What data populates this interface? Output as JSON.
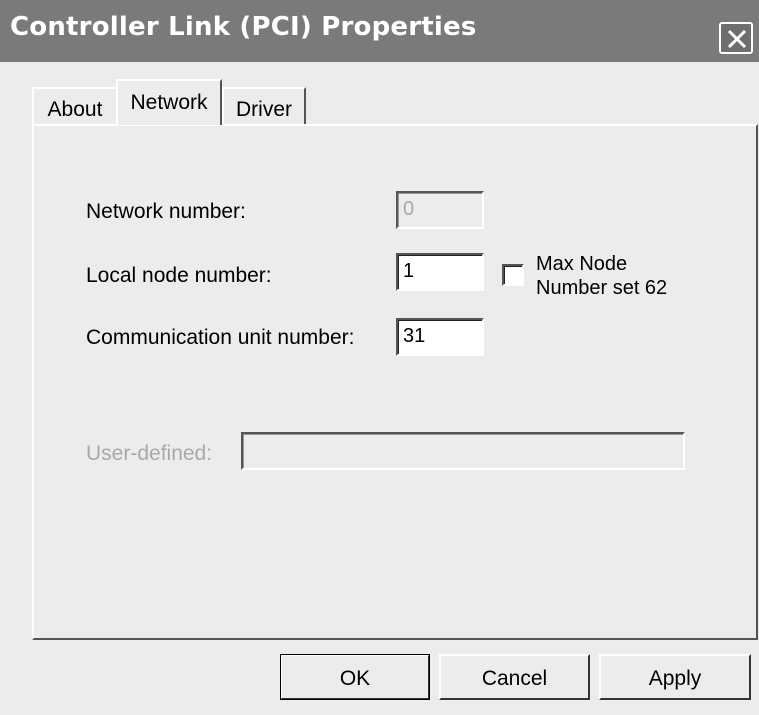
{
  "window": {
    "title": "Controller Link (PCI) Properties"
  },
  "tabs": [
    {
      "label": "About"
    },
    {
      "label": "Network"
    },
    {
      "label": "Driver"
    }
  ],
  "form": {
    "network_number_label": "Network number:",
    "network_number_value": "0",
    "local_node_label": "Local node number:",
    "local_node_value": "1",
    "max_node_checkbox_label_line1": "Max Node",
    "max_node_checkbox_label_line2": "Number set 62",
    "comm_unit_label": "Communication unit number:",
    "comm_unit_value": "31",
    "user_defined_label": "User-defined:",
    "user_defined_value": ""
  },
  "buttons": {
    "ok": "OK",
    "cancel": "Cancel",
    "apply": "Apply"
  }
}
